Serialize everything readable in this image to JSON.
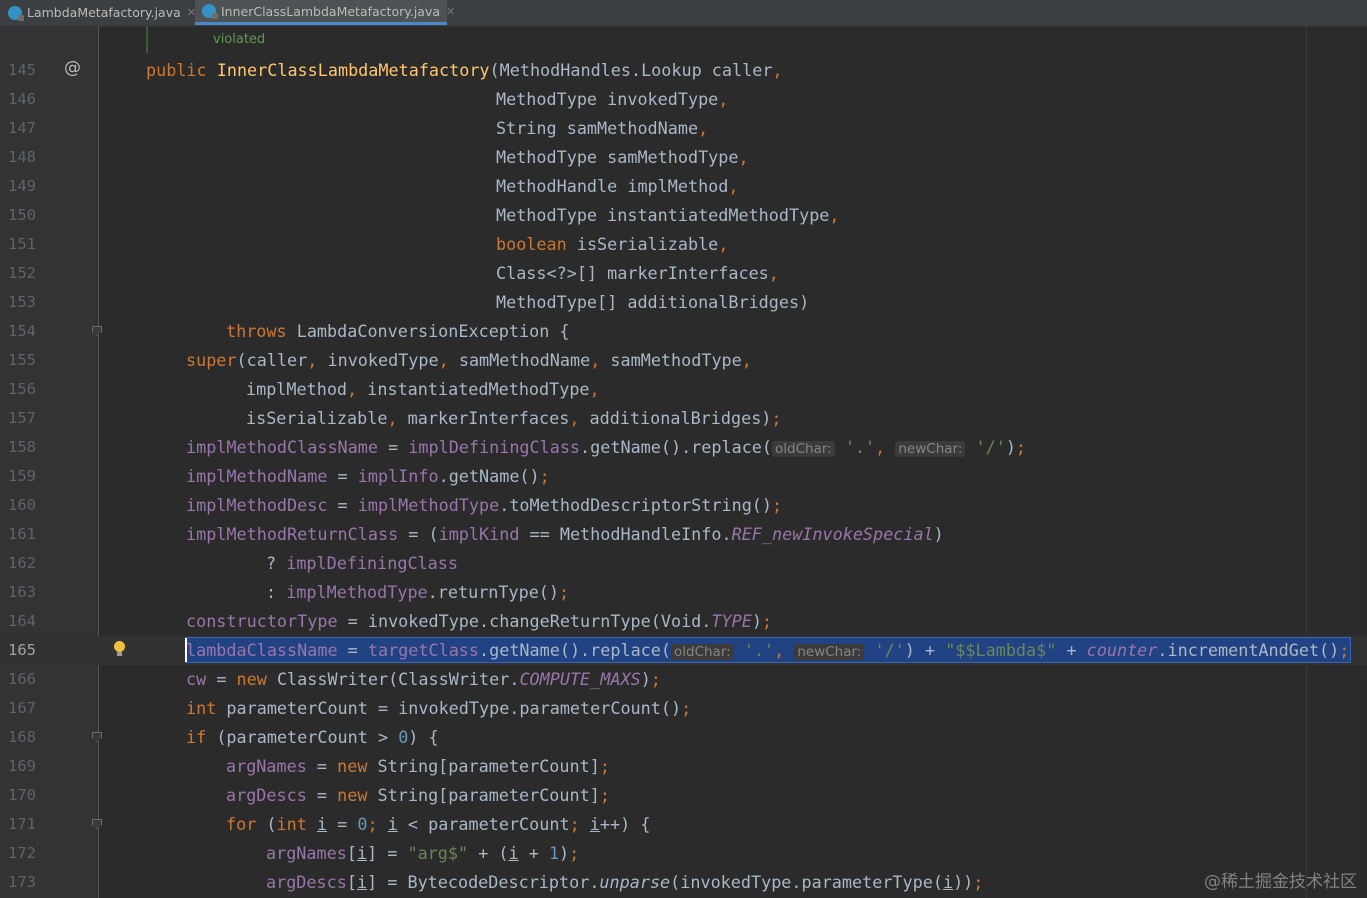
{
  "tabs": [
    {
      "label": "LambdaMetafactory.java",
      "active": false
    },
    {
      "label": "InnerClassLambdaMetafactory.java",
      "active": true
    }
  ],
  "doc_preview": "violated",
  "watermark": "@稀土掘金技术社区",
  "gutter": {
    "override_marker": "@"
  },
  "hints": {
    "l158_oldchar": "oldChar:",
    "l158_newchar": "newChar:",
    "l165_oldchar": "oldChar:",
    "l165_newchar": "newChar:"
  },
  "lines": {
    "n145": "145",
    "n146": "146",
    "n147": "147",
    "n148": "148",
    "n149": "149",
    "n150": "150",
    "n151": "151",
    "n152": "152",
    "n153": "153",
    "n154": "154",
    "n155": "155",
    "n156": "156",
    "n157": "157",
    "n158": "158",
    "n159": "159",
    "n160": "160",
    "n161": "161",
    "n162": "162",
    "n163": "163",
    "n164": "164",
    "n165": "165",
    "n166": "166",
    "n167": "167",
    "n168": "168",
    "n169": "169",
    "n170": "170",
    "n171": "171",
    "n172": "172",
    "n173": "173"
  },
  "code": {
    "l145": [
      "public",
      " ",
      "InnerClassLambdaMetafactory",
      "(MethodHandles.Lookup caller",
      ","
    ],
    "l146": [
      "MethodType invokedType",
      ","
    ],
    "l147": [
      "String samMethodName",
      ","
    ],
    "l148": [
      "MethodType samMethodType",
      ","
    ],
    "l149": [
      "MethodHandle implMethod",
      ","
    ],
    "l150": [
      "MethodType instantiatedMethodType",
      ","
    ],
    "l151": [
      "boolean",
      " isSerializable",
      ","
    ],
    "l152": [
      "Class<?>[] markerInterfaces",
      ","
    ],
    "l153": [
      "MethodType[] additionalBridges)"
    ],
    "l154": [
      "throws",
      " LambdaConversionException {"
    ],
    "l155": [
      "super",
      "(caller",
      ", ",
      "invokedType",
      ", ",
      "samMethodName",
      ", ",
      "samMethodType",
      ","
    ],
    "l156": [
      "implMethod",
      ", ",
      "instantiatedMethodType",
      ","
    ],
    "l157": [
      "isSerializable",
      ", ",
      "markerInterfaces",
      ", ",
      "additionalBridges)",
      ";"
    ],
    "l158": [
      "implMethodClassName",
      " = ",
      "implDefiningClass",
      ".getName().replace(",
      "'.'",
      ", ",
      "'/'",
      ")",
      ";"
    ],
    "l159": [
      "implMethodName",
      " = ",
      "implInfo",
      ".getName()",
      ";"
    ],
    "l160": [
      "implMethodDesc",
      " = ",
      "implMethodType",
      ".toMethodDescriptorString()",
      ";"
    ],
    "l161": [
      "implMethodReturnClass",
      " = (",
      "implKind",
      " == MethodHandleInfo.",
      "REF_newInvokeSpecial",
      ")"
    ],
    "l162": [
      "? ",
      "implDefiningClass"
    ],
    "l163": [
      ": ",
      "implMethodType",
      ".returnType()",
      ";"
    ],
    "l164": [
      "constructorType",
      " = invokedType.changeReturnType(Void.",
      "TYPE",
      ")",
      ";"
    ],
    "l165": [
      "lambdaClassName",
      " = ",
      "targetClass",
      ".getName().replace(",
      "'.'",
      ", ",
      "'/'",
      ") + ",
      "\"$$Lambda$\"",
      " + ",
      "counter",
      ".incrementAndGet()",
      ";"
    ],
    "l166": [
      "cw",
      " = ",
      "new",
      " ClassWriter(ClassWriter.",
      "COMPUTE_MAXS",
      ")",
      ";"
    ],
    "l167": [
      "int",
      " parameterCount = invokedType.parameterCount()",
      ";"
    ],
    "l168": [
      "if",
      " (parameterCount > ",
      "0",
      ") {"
    ],
    "l169": [
      "argNames",
      " = ",
      "new",
      " String[parameterCount]",
      ";"
    ],
    "l170": [
      "argDescs",
      " = ",
      "new",
      " String[parameterCount]",
      ";"
    ],
    "l171": [
      "for",
      " (",
      "int",
      " ",
      "i",
      " = ",
      "0",
      "; ",
      "i",
      " < parameterCount",
      "; ",
      "i",
      "++) {"
    ],
    "l172": [
      "argNames",
      "[",
      "i",
      "] = ",
      "\"arg$\"",
      " + (",
      "i",
      " + ",
      "1",
      ")",
      ";"
    ],
    "l173": [
      "argDescs",
      "[",
      "i",
      "] = BytecodeDescriptor.",
      "unparse",
      "(invokedType.parameterType(",
      "i",
      "))",
      ";"
    ]
  },
  "colors": {
    "background": "#2b2b2b",
    "keyword": "#cc7832",
    "method_decl": "#ffc66d",
    "field": "#9876aa",
    "string": "#6a8759",
    "number": "#6897bb",
    "selection": "#214283"
  },
  "icons": [
    "java-class-icon",
    "close-icon",
    "override-icon",
    "fold-icon",
    "lightbulb-icon"
  ]
}
